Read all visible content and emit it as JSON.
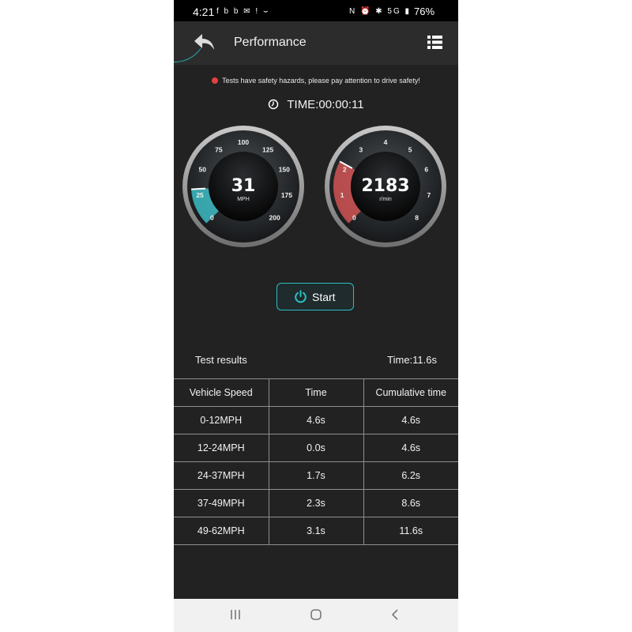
{
  "status_bar": {
    "time": "4:21",
    "left_icons": "f b b ✉ ! ⌣",
    "right_icons": "N ⏰ ✱ 5G ▮",
    "battery": "76%"
  },
  "app_bar": {
    "title": "Performance"
  },
  "warning": "Tests have safety hazards, please pay attention to drive safety!",
  "timer": {
    "text": "TIME:00:00:11"
  },
  "speed_gauge": {
    "value": "31",
    "unit": "MPH",
    "ticks": [
      "0",
      "25",
      "50",
      "75",
      "100",
      "125",
      "150",
      "175",
      "200"
    ],
    "min": 0,
    "max": 200,
    "current": 31,
    "color": "#3fd0d8"
  },
  "rpm_gauge": {
    "value": "2183",
    "unit": "r/min",
    "ticks": [
      "0",
      "1",
      "2",
      "3",
      "4",
      "5",
      "6",
      "7",
      "8"
    ],
    "min": 0,
    "max": 8,
    "current": 2.183,
    "color": "#e85a5a"
  },
  "start_button": {
    "label": "Start",
    "icon": "power-icon"
  },
  "results": {
    "title": "Test results",
    "total_time": "Time:11.6s",
    "columns": [
      "Vehicle Speed",
      "Time",
      "Cumulative time"
    ],
    "rows": [
      [
        "0-12MPH",
        "4.6s",
        "4.6s"
      ],
      [
        "12-24MPH",
        "0.0s",
        "4.6s"
      ],
      [
        "24-37MPH",
        "1.7s",
        "6.2s"
      ],
      [
        "37-49MPH",
        "2.3s",
        "8.6s"
      ],
      [
        "49-62MPH",
        "3.1s",
        "11.6s"
      ]
    ]
  },
  "colors": {
    "accent": "#2bbfc4",
    "background": "#222222",
    "warning": "#e34040"
  }
}
